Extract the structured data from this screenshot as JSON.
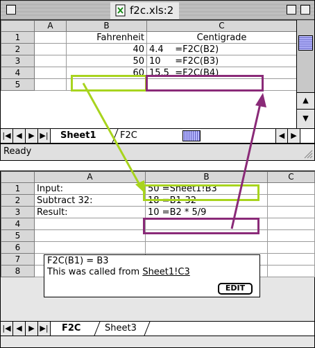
{
  "window": {
    "title": "f2c.xls:2"
  },
  "sheet1": {
    "columns": [
      "A",
      "B",
      "C"
    ],
    "rows": [
      {
        "num": "1",
        "a": "",
        "b": "Fahrenheit",
        "c": "Centigrade"
      },
      {
        "num": "2",
        "a": "",
        "b": "40",
        "c": "4.4    =F2C(B2)"
      },
      {
        "num": "3",
        "a": "",
        "b": "50",
        "c": "10     =F2C(B3)"
      },
      {
        "num": "4",
        "a": "",
        "b": "60",
        "c": "15.5  =F2C(B4)"
      },
      {
        "num": "5",
        "a": "",
        "b": "",
        "c": ""
      }
    ],
    "tabs": [
      "Sheet1",
      "F2C"
    ],
    "status": "Ready"
  },
  "f2c_sheet": {
    "columns": [
      "A",
      "B",
      "C"
    ],
    "rows": [
      {
        "num": "1",
        "a": "Input:",
        "b": "50  =Sheet1!B3"
      },
      {
        "num": "2",
        "a": "Subtract 32:",
        "b": "18  =B1-32"
      },
      {
        "num": "3",
        "a": "Result:",
        "b": "10  =B2 * 5/9"
      },
      {
        "num": "4",
        "a": "",
        "b": ""
      },
      {
        "num": "5",
        "a": "",
        "b": ""
      },
      {
        "num": "6",
        "a": "",
        "b": ""
      },
      {
        "num": "7",
        "a": "",
        "b": ""
      },
      {
        "num": "8",
        "a": "",
        "b": ""
      }
    ],
    "function_box": {
      "line1": "F2C(B1) = B3",
      "line2_prefix": "This was called from ",
      "line2_link": "Sheet1!C3",
      "edit_label": "EDIT"
    },
    "tabs": [
      "F2C",
      "Sheet3"
    ]
  },
  "colors": {
    "input_highlight": "#a8d41e",
    "output_highlight": "#8a2a78"
  }
}
